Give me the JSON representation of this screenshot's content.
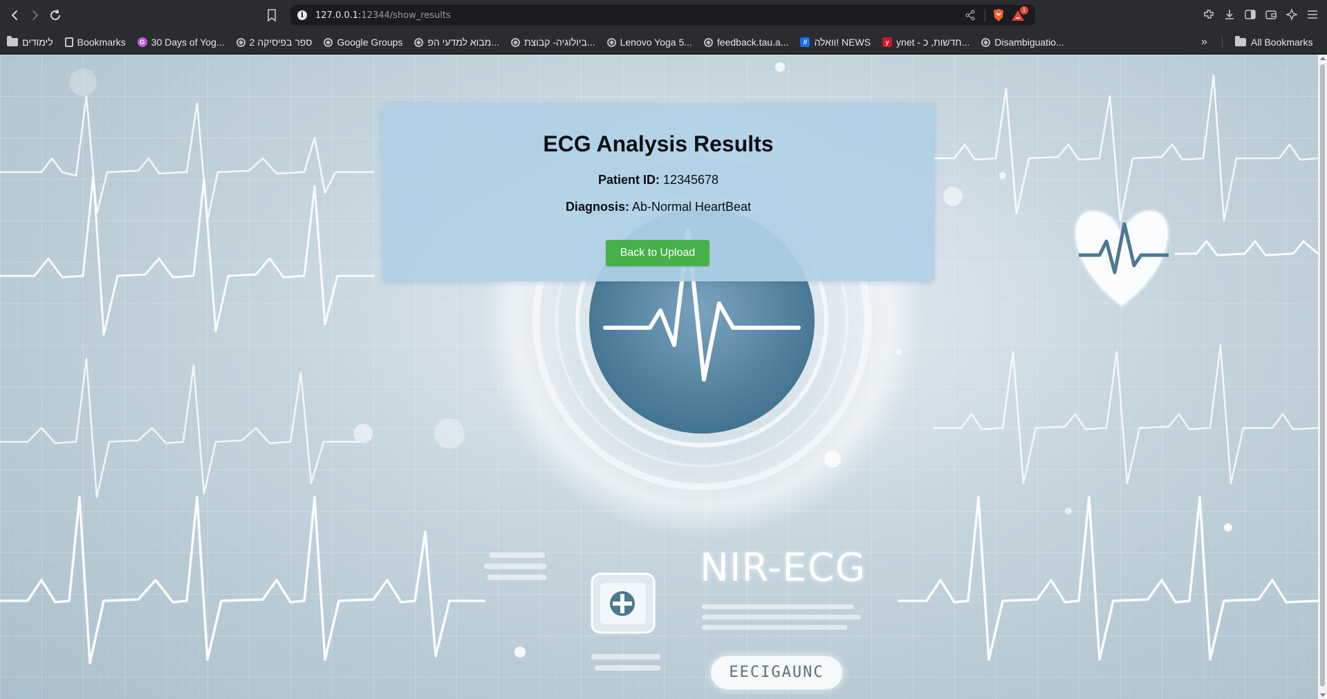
{
  "browser": {
    "url_host": "127.0.0.1:",
    "url_path": "12344/show_results",
    "rewards_badge": "1",
    "icons": [
      "back-icon",
      "forward-icon",
      "reload-icon",
      "bookmark-icon",
      "site-info-icon",
      "share-icon",
      "brave-shield-icon",
      "brave-rewards-icon",
      "extensions-icon",
      "downloads-icon",
      "sidebar-icon",
      "wallet-icon",
      "leo-icon",
      "menu-icon"
    ]
  },
  "bookmarks": {
    "items": [
      {
        "label": "לימודים",
        "icon": "folder-icon"
      },
      {
        "label": "Bookmarks",
        "icon": "bookmarks-icon"
      },
      {
        "label": "30 Days of Yog...",
        "icon": "g-icon"
      },
      {
        "label": "ספר בפיסיקה 2",
        "icon": "globe-icon"
      },
      {
        "label": "Google Groups",
        "icon": "globe-icon"
      },
      {
        "label": "מבוא למדעי הפ...",
        "icon": "globe-icon"
      },
      {
        "label": "ביולוגיה- קבוצת...",
        "icon": "globe-icon"
      },
      {
        "label": "Lenovo Yoga 5...",
        "icon": "globe-icon"
      },
      {
        "label": "feedback.tau.a...",
        "icon": "globe-icon"
      },
      {
        "label": "וואלה! NEWS",
        "icon": "walla-icon"
      },
      {
        "label": "ynet - חדשות, כ...",
        "icon": "ynet-icon"
      },
      {
        "label": "Disambiguatio...",
        "icon": "globe-icon"
      }
    ],
    "more": "»",
    "all_bookmarks": "All Bookmarks"
  },
  "result": {
    "title": "ECG Analysis Results",
    "patient_id_label": "Patient ID:",
    "patient_id": "12345678",
    "diagnosis_label": "Diagnosis:",
    "diagnosis": "Ab-Normal HeartBeat",
    "back_button": "Back to Upload"
  },
  "background": {
    "brand": "NIR-ECG",
    "pill_text": "EECIGAUNC"
  },
  "colors": {
    "button_green": "#47b04b",
    "card_blue": "#b0d0e6"
  }
}
